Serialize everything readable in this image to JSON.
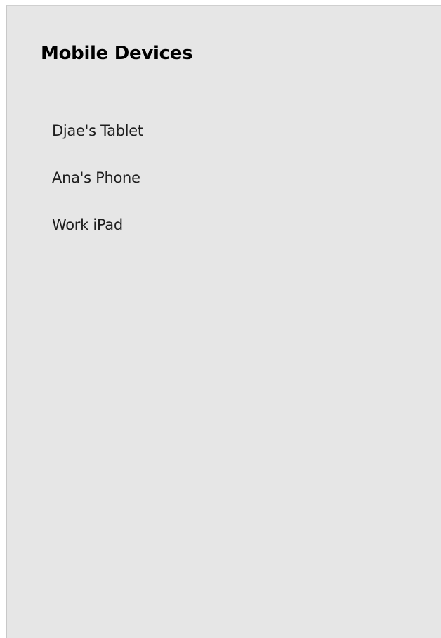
{
  "panel": {
    "title": "Mobile Devices",
    "devices": [
      {
        "label": "Djae's Tablet"
      },
      {
        "label": "Ana's Phone"
      },
      {
        "label": "Work iPad"
      }
    ]
  },
  "colors": {
    "panel_background": "#e6e6e6",
    "title_text": "#000000",
    "item_text": "#1e1e1e"
  }
}
